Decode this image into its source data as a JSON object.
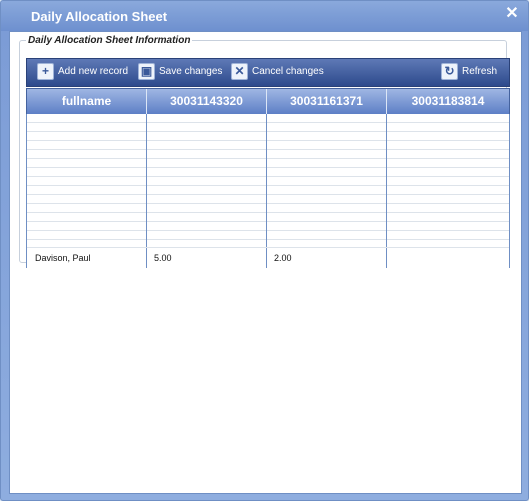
{
  "window": {
    "title": "Daily Allocation Sheet",
    "close_glyph": "✕"
  },
  "panel": {
    "legend": "Daily Allocation Sheet Information"
  },
  "toolbar": {
    "add_label": "Add new record",
    "save_label": "Save changes",
    "cancel_label": "Cancel changes",
    "refresh_label": "Refresh",
    "add_icon": "plus-icon",
    "save_icon": "disk-icon",
    "cancel_icon": "x-icon",
    "refresh_icon": "refresh-icon"
  },
  "grid": {
    "columns": [
      "fullname",
      "30031143320",
      "30031161371",
      "30031183814"
    ],
    "rows": [
      [
        "Davison, Paul",
        "5.00",
        "2.00",
        ""
      ]
    ]
  },
  "colors": {
    "header": "#5d7fc6",
    "toolbar": "#2d4a8c",
    "frame": "#6f8fc4"
  }
}
